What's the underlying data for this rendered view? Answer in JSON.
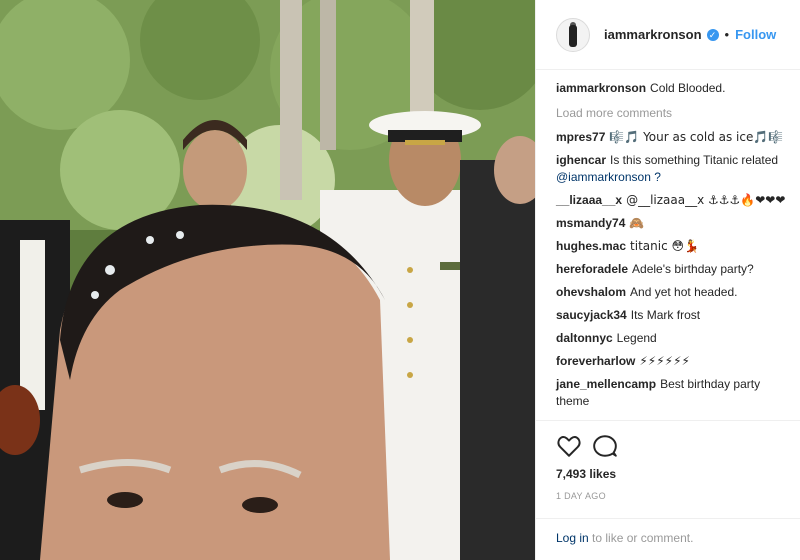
{
  "post": {
    "image_description": "",
    "username": "iammarkronson",
    "follow_label": "Follow",
    "dot": "•",
    "caption": "Cold Blooded.",
    "load_more": "Load more comments",
    "comments": [
      {
        "user": "mpres77",
        "text": "🎼🎵 Your as cold as ice🎵🎼"
      },
      {
        "user": "ighencar",
        "text": "Is this something Titanic related",
        "mention": "@iammarkronson ?"
      },
      {
        "user": "__lizaaa__x",
        "text": "@__lizaaa__x ⚓⚓⚓🔥❤❤❤"
      },
      {
        "user": "msmandy74",
        "text": "🙈"
      },
      {
        "user": "hughes.mac",
        "text": "titanic 😳💃"
      },
      {
        "user": "hereforadele",
        "text": "Adele's birthday party?"
      },
      {
        "user": "ohevshalom",
        "text": "And yet hot headed."
      },
      {
        "user": "saucyjack34",
        "text": "Its Mark frost"
      },
      {
        "user": "daltonnyc",
        "text": "Legend"
      },
      {
        "user": "foreverharlow",
        "text": "⚡⚡⚡⚡⚡⚡"
      },
      {
        "user": "jane_mellencamp",
        "text": "Best birthday party theme"
      }
    ],
    "likes": "7,493 likes",
    "time_ago": "1 DAY AGO",
    "login_link": "Log in",
    "login_rest": " to like or comment."
  },
  "icons": {
    "verified": "verified-badge-icon",
    "like": "heart-icon",
    "comment": "comment-icon"
  },
  "colors": {
    "link": "#3897f0",
    "text": "#262626",
    "muted": "#999999"
  }
}
